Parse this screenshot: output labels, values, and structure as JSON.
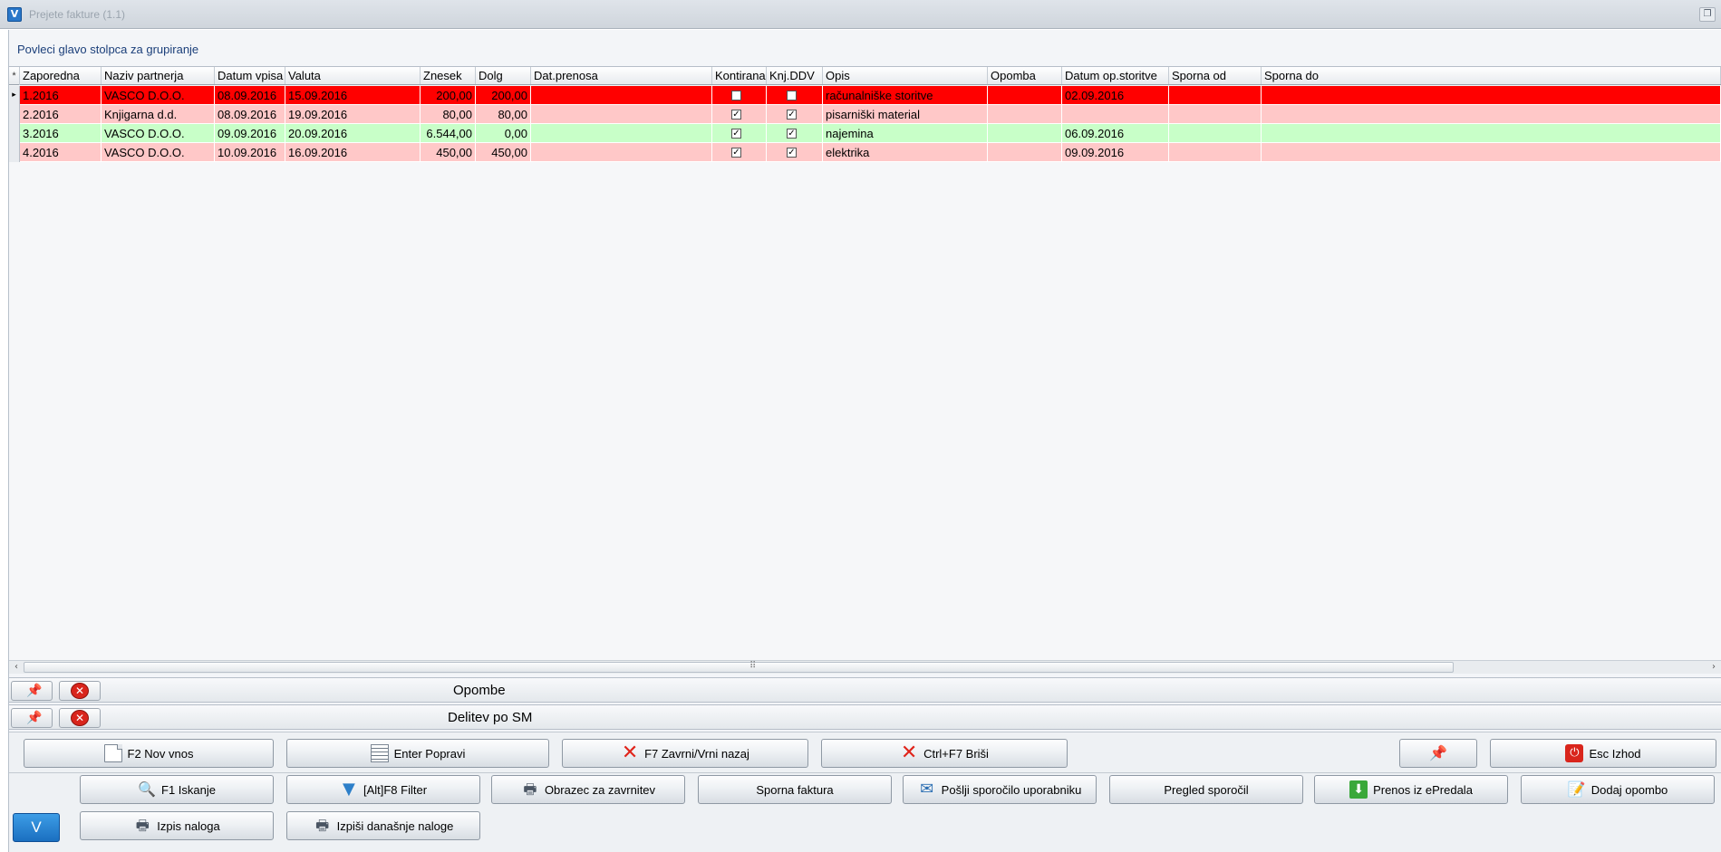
{
  "window": {
    "title": "Prejete fakture  (1.1)",
    "app_icon": "V",
    "restore_glyph": "❐"
  },
  "group_hint": "Povleci glavo stolpca za grupiranje",
  "grid": {
    "indicator_header": "*",
    "columns": [
      "Zaporedna",
      "Naziv partnerja",
      "Datum vpisa",
      "Valuta",
      "Znesek",
      "Dolg",
      "Dat.prenosa",
      "Kontirana",
      "Knj.DDV",
      "Opis",
      "Opomba",
      "Datum op.storitve",
      "Sporna od",
      "Sporna do"
    ],
    "rows": [
      {
        "zaporedna": "1.2016",
        "partner": "VASCO D.O.O.",
        "datum_vpisa": "08.09.2016",
        "valuta": "15.09.2016",
        "znesek": "200,00",
        "dolg": "200,00",
        "dat_prenosa": "",
        "kontirana": false,
        "knj_ddv": false,
        "opis": "računalniške storitve",
        "opomba": "",
        "datum_op": "02.09.2016",
        "sporna_od": "",
        "sporna_do": "",
        "color": "#ff0000",
        "selected": true
      },
      {
        "zaporedna": "2.2016",
        "partner": "Knjigarna d.d.",
        "datum_vpisa": "08.09.2016",
        "valuta": "19.09.2016",
        "znesek": "80,00",
        "dolg": "80,00",
        "dat_prenosa": "",
        "kontirana": true,
        "knj_ddv": true,
        "opis": "pisarniški material",
        "opomba": "",
        "datum_op": "",
        "sporna_od": "",
        "sporna_do": "",
        "color": "#ffc8c8",
        "selected": false
      },
      {
        "zaporedna": "3.2016",
        "partner": "VASCO D.O.O.",
        "datum_vpisa": "09.09.2016",
        "valuta": "20.09.2016",
        "znesek": "6.544,00",
        "dolg": "0,00",
        "dat_prenosa": "",
        "kontirana": true,
        "knj_ddv": true,
        "opis": "najemina",
        "opomba": "",
        "datum_op": "06.09.2016",
        "sporna_od": "",
        "sporna_do": "",
        "color": "#c8ffc8",
        "selected": false
      },
      {
        "zaporedna": "4.2016",
        "partner": "VASCO D.O.O.",
        "datum_vpisa": "10.09.2016",
        "valuta": "16.09.2016",
        "znesek": "450,00",
        "dolg": "450,00",
        "dat_prenosa": "",
        "kontirana": true,
        "knj_ddv": true,
        "opis": "elektrika",
        "opomba": "",
        "datum_op": "09.09.2016",
        "sporna_od": "",
        "sporna_do": "",
        "color": "#ffc8c8",
        "selected": false
      }
    ]
  },
  "scrollbar": {
    "left_arrow": "‹",
    "right_arrow": "›",
    "grip": "⠿"
  },
  "panels": {
    "opombe": {
      "title": "Opombe"
    },
    "delitev": {
      "title": "Delitev po SM"
    },
    "pin_glyph": "📌",
    "close_glyph": "✕"
  },
  "toolbar_row1": [
    {
      "label": "F2 Nov vnos",
      "icon": "new-document-icon"
    },
    {
      "label": "Enter Popravi",
      "icon": "edit-document-icon"
    },
    {
      "label": "F7 Zavrni/Vrni nazaj",
      "icon": "red-x-icon"
    },
    {
      "label": "Ctrl+F7 Briši",
      "icon": "red-x-icon"
    },
    {
      "label": "",
      "icon": "pin-icon"
    },
    {
      "label": "Esc Izhod",
      "icon": "power-icon"
    }
  ],
  "toolbar_row2": [
    {
      "label": "F1 Iskanje",
      "icon": "search-icon"
    },
    {
      "label": "[Alt]F8 Filter",
      "icon": "filter-icon"
    },
    {
      "label": "Obrazec za zavrnitev",
      "icon": "printer-icon"
    },
    {
      "label": "Sporna faktura",
      "icon": ""
    },
    {
      "label": "Pošlji sporočilo uporabniku",
      "icon": "mail-icon"
    },
    {
      "label": "Pregled sporočil",
      "icon": ""
    },
    {
      "label": "Prenos iz ePredala",
      "icon": "download-icon"
    },
    {
      "label": "Dodaj opombo",
      "icon": "note-icon"
    }
  ],
  "toolbar_row3": [
    {
      "label": "Izpis naloga",
      "icon": "printer-icon"
    },
    {
      "label": "Izpiši današnje naloge",
      "icon": "printer-icon"
    }
  ],
  "icons": {
    "red_x": "✕",
    "pin": "📌",
    "power": "⏻",
    "search": "🔍",
    "filter": "▼",
    "printer": "🖶",
    "mail": "✉",
    "download": "⬇",
    "note": "📝"
  },
  "v_button": "V"
}
